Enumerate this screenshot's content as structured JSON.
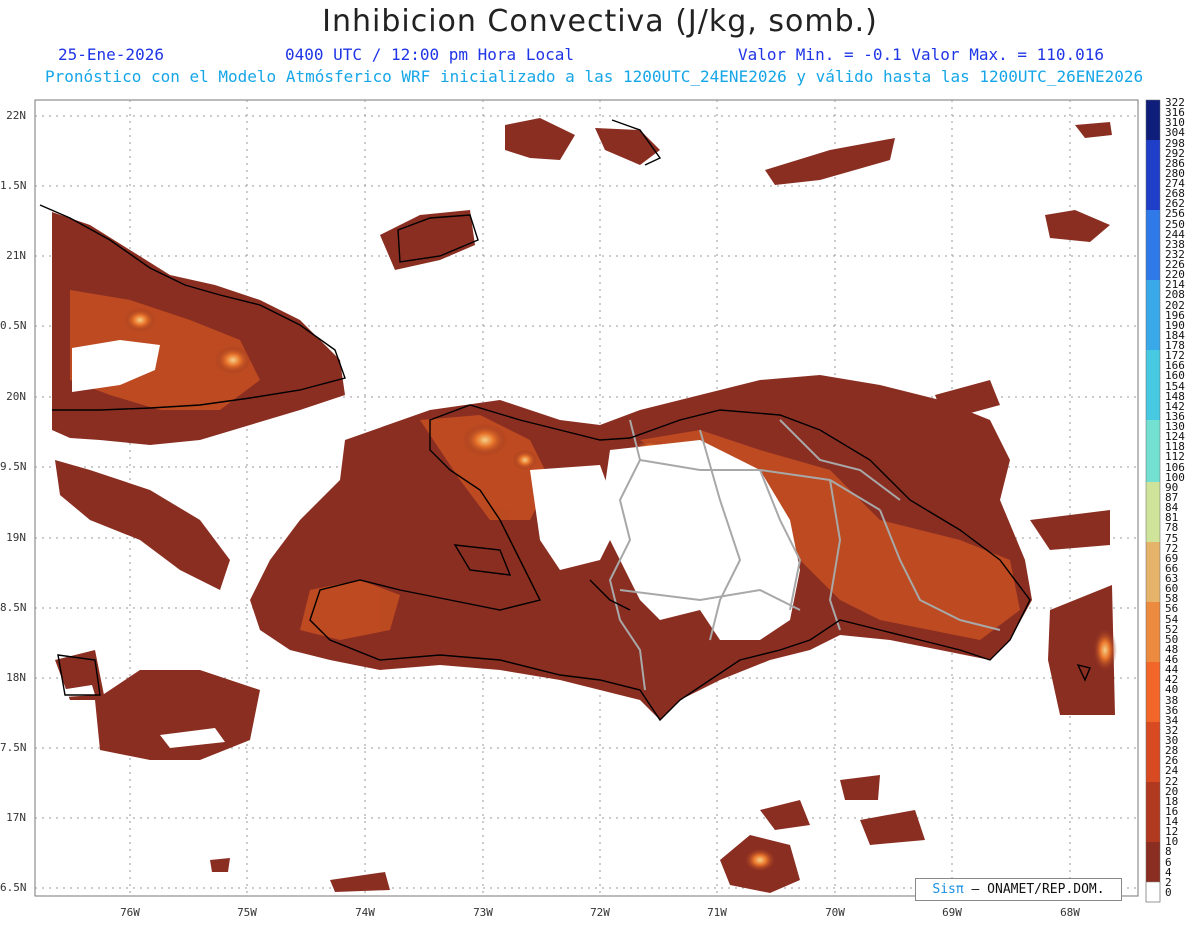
{
  "header": {
    "title": "Inhibicion Convectiva (J/kg, somb.)",
    "date": "25-Ene-2026",
    "time": "0400 UTC / 12:00 pm Hora Local",
    "minmax": "Valor Min. = -0.1  Valor Max. = 110.016",
    "forecast_note": "Pronóstico con el Modelo Atmósferico WRF inicializado a las 1200UTC_24ENE2026 y válido hasta las  1200UTC_26ENE2026"
  },
  "axes": {
    "lat_labels": [
      "22N",
      "1.5N",
      "21N",
      "0.5N",
      "20N",
      "9.5N",
      "19N",
      "8.5N",
      "18N",
      "7.5N",
      "17N",
      "6.5N"
    ],
    "lon_labels": [
      "76W",
      "75W",
      "74W",
      "73W",
      "72W",
      "71W",
      "70W",
      "69W",
      "68W"
    ]
  },
  "colorbar": {
    "labels": [
      "322",
      "316",
      "310",
      "304",
      "298",
      "292",
      "286",
      "280",
      "274",
      "268",
      "262",
      "256",
      "250",
      "244",
      "238",
      "232",
      "226",
      "220",
      "214",
      "208",
      "202",
      "196",
      "190",
      "184",
      "178",
      "172",
      "166",
      "160",
      "154",
      "148",
      "142",
      "136",
      "130",
      "124",
      "118",
      "112",
      "106",
      "100",
      "90",
      "87",
      "84",
      "81",
      "78",
      "75",
      "72",
      "69",
      "66",
      "63",
      "60",
      "58",
      "56",
      "54",
      "52",
      "50",
      "48",
      "46",
      "44",
      "42",
      "40",
      "38",
      "36",
      "34",
      "32",
      "30",
      "28",
      "26",
      "24",
      "22",
      "20",
      "18",
      "16",
      "14",
      "12",
      "10",
      "8",
      "6",
      "4",
      "2",
      "0"
    ]
  },
  "credit": {
    "logo": "Sisπ",
    "text": " – ONAMET/REP.DOM."
  },
  "colors": {
    "field_dark": "#8b2e22",
    "field_mid": "#b8461f",
    "field_bright": "#e8742a",
    "land_blank": "#ffffff",
    "coast": "#000000",
    "borders": "#a8a8a8"
  }
}
